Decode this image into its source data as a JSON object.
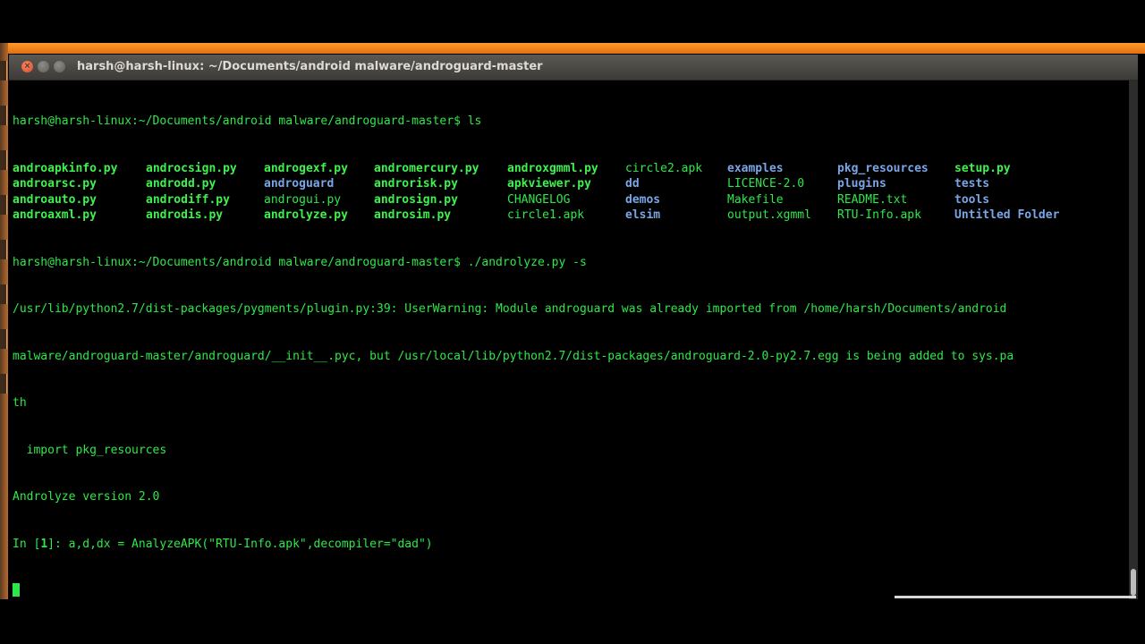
{
  "window": {
    "title": "harsh@harsh-linux: ~/Documents/android malware/androguard-master"
  },
  "terminal": {
    "prompt1": "harsh@harsh-linux:~/Documents/android malware/androguard-master$ ls",
    "ls_rows": [
      [
        "androapkinfo.py",
        "androcsign.py",
        "androgexf.py",
        "andromercury.py",
        "androxgmml.py",
        "circle2.apk",
        "examples",
        "pkg_resources",
        "setup.py"
      ],
      [
        "androarsc.py",
        "androdd.py",
        "androguard",
        "androrisk.py",
        "apkviewer.py",
        "dd",
        "LICENCE-2.0",
        "plugins",
        "tests"
      ],
      [
        "androauto.py",
        "androdiff.py",
        "androgui.py",
        "androsign.py",
        "CHANGELOG",
        "demos",
        "Makefile",
        "README.txt",
        "tools"
      ],
      [
        "androaxml.py",
        "androdis.py",
        "androlyze.py",
        "androsim.py",
        "circle1.apk",
        "elsim",
        "output.xgmml",
        "RTU-Info.apk",
        "Untitled Folder"
      ]
    ],
    "prompt2": "harsh@harsh-linux:~/Documents/android malware/androguard-master$ ./androlyze.py -s",
    "warning1": "/usr/lib/python2.7/dist-packages/pygments/plugin.py:39: UserWarning: Module androguard was already imported from /home/harsh/Documents/android",
    "warning2": "malware/androguard-master/androguard/__init__.pyc, but /usr/local/lib/python2.7/dist-packages/androguard-2.0-py2.7.egg is being added to sys.pa",
    "warning3": "th",
    "import_line": "  import pkg_resources",
    "version_line": "Androlyze version 2.0",
    "in_prefix": "In [",
    "in_number": "1",
    "in_suffix": "]: a,d,dx = AnalyzeAPK(\"RTU-Info.apk\",decompiler=\"dad\")"
  },
  "colors": {
    "terminal_text": "#2ee84a",
    "directory": "#7aa5e6",
    "background": "#000000",
    "titlebar": "#3c3b37"
  }
}
